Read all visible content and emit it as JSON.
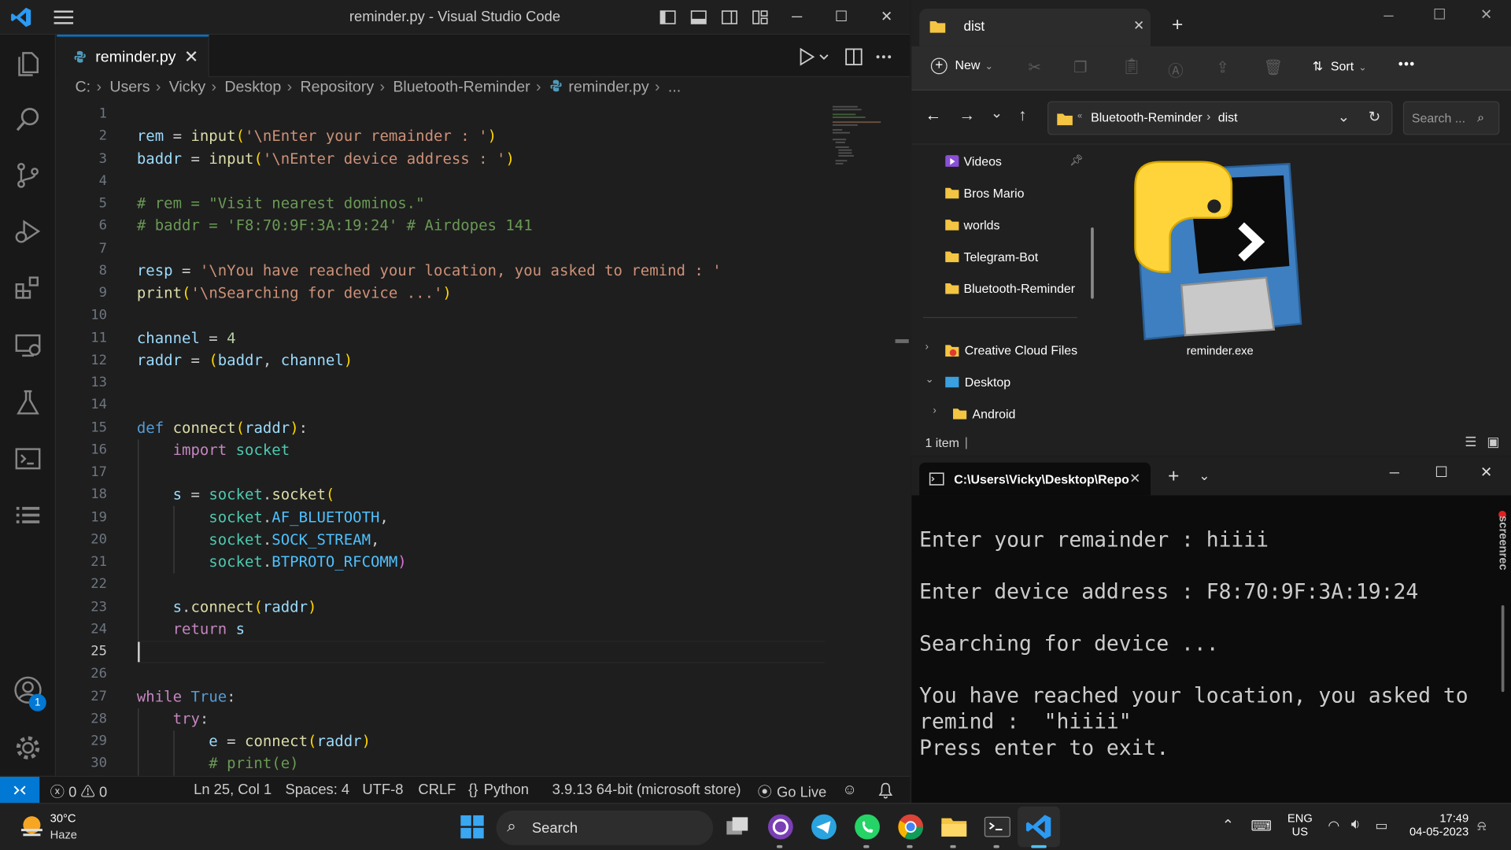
{
  "vscode": {
    "title": "reminder.py - Visual Studio Code",
    "tab": {
      "label": "reminder.py",
      "close": "✕"
    },
    "breadcrumbs": [
      "C:",
      "Users",
      "Vicky",
      "Desktop",
      "Repository",
      "Bluetooth-Reminder",
      "reminder.py",
      "..."
    ],
    "account_badge": "1",
    "line_numbers": [
      "1",
      "2",
      "3",
      "4",
      "5",
      "6",
      "7",
      "8",
      "9",
      "10",
      "11",
      "12",
      "13",
      "14",
      "15",
      "16",
      "17",
      "18",
      "19",
      "20",
      "21",
      "22",
      "23",
      "24",
      "25",
      "26",
      "27",
      "28",
      "29",
      "30"
    ],
    "code_lines": [
      "",
      "rem = input('\\nEnter your remainder : ')",
      "baddr = input('\\nEnter device address : ')",
      "",
      "# rem = \"Visit nearest dominos.\"",
      "# baddr = 'F8:70:9F:3A:19:24' # Airdopes 141",
      "",
      "resp = '\\nYou have reached your location, you asked to remind : '",
      "print('\\nSearching for device ...')",
      "",
      "channel = 4",
      "raddr = (baddr, channel)",
      "",
      "",
      "def connect(raddr):",
      "    import socket",
      "",
      "    s = socket.socket(",
      "        socket.AF_BLUETOOTH,",
      "        socket.SOCK_STREAM,",
      "        socket.BTPROTO_RFCOMM)",
      "",
      "    s.connect(raddr)",
      "    return s",
      "",
      "",
      "while True:",
      "    try:",
      "        e = connect(raddr)",
      "        # print(e)"
    ],
    "status": {
      "errors": "0",
      "warnings": "0",
      "position": "Ln 25, Col 1",
      "spaces": "Spaces: 4",
      "encoding": "UTF-8",
      "eol": "CRLF",
      "language": "Python",
      "interpreter": "3.9.13 64-bit (microsoft store)",
      "golive": "Go Live"
    }
  },
  "explorer": {
    "tab_title": "dist",
    "toolbar": {
      "new_label": "New",
      "sort_label": "Sort",
      "more": "•••"
    },
    "address": {
      "parent": "Bluetooth-Reminder",
      "current": "dist",
      "search_placeholder": "Search ..."
    },
    "nav_items": [
      {
        "label": "Videos",
        "pinned": true
      },
      {
        "label": "Bros Mario"
      },
      {
        "label": "worlds"
      },
      {
        "label": "Telegram-Bot"
      },
      {
        "label": "Bluetooth-Reminder"
      },
      {
        "label": "Creative Cloud Files"
      },
      {
        "label": "Desktop"
      },
      {
        "label": "Android"
      }
    ],
    "files": [
      {
        "name": "reminder.exe"
      }
    ],
    "status": "1 item",
    "status_sep": "|"
  },
  "terminal": {
    "tab_title": "C:\\Users\\Vicky\\Desktop\\Repo",
    "lines": [
      "Enter your remainder : hiiii",
      "",
      "Enter device address : F8:70:9F:3A:19:24",
      "",
      "Searching for device ...",
      "",
      "You have reached your location, you asked to",
      "remind :  \"hiiii\"",
      "Press enter to exit."
    ],
    "watermark": "screenrec"
  },
  "taskbar": {
    "weather": {
      "temp": "30°C",
      "condition": "Haze"
    },
    "search_label": "Search",
    "lang": {
      "line1": "ENG",
      "line2": "US"
    },
    "clock": {
      "time": "17:49",
      "date": "04-05-2023"
    }
  },
  "colors": {
    "accent": "#0078d4",
    "python_blue": "#3776ab",
    "python_yellow": "#ffd43b"
  }
}
